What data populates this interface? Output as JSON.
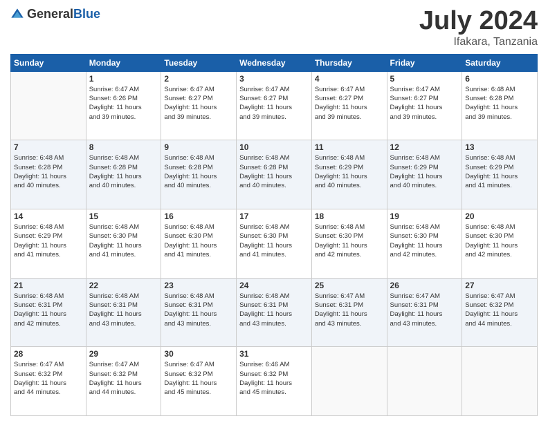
{
  "header": {
    "logo_general": "General",
    "logo_blue": "Blue",
    "month_title": "July 2024",
    "location": "Ifakara, Tanzania"
  },
  "days_of_week": [
    "Sunday",
    "Monday",
    "Tuesday",
    "Wednesday",
    "Thursday",
    "Friday",
    "Saturday"
  ],
  "weeks": [
    [
      {
        "day": "",
        "sunrise": "",
        "sunset": "",
        "daylight": "",
        "empty": true
      },
      {
        "day": "1",
        "sunrise": "Sunrise: 6:47 AM",
        "sunset": "Sunset: 6:26 PM",
        "daylight": "Daylight: 11 hours",
        "minutes": "and 39 minutes."
      },
      {
        "day": "2",
        "sunrise": "Sunrise: 6:47 AM",
        "sunset": "Sunset: 6:27 PM",
        "daylight": "Daylight: 11 hours",
        "minutes": "and 39 minutes."
      },
      {
        "day": "3",
        "sunrise": "Sunrise: 6:47 AM",
        "sunset": "Sunset: 6:27 PM",
        "daylight": "Daylight: 11 hours",
        "minutes": "and 39 minutes."
      },
      {
        "day": "4",
        "sunrise": "Sunrise: 6:47 AM",
        "sunset": "Sunset: 6:27 PM",
        "daylight": "Daylight: 11 hours",
        "minutes": "and 39 minutes."
      },
      {
        "day": "5",
        "sunrise": "Sunrise: 6:47 AM",
        "sunset": "Sunset: 6:27 PM",
        "daylight": "Daylight: 11 hours",
        "minutes": "and 39 minutes."
      },
      {
        "day": "6",
        "sunrise": "Sunrise: 6:48 AM",
        "sunset": "Sunset: 6:28 PM",
        "daylight": "Daylight: 11 hours",
        "minutes": "and 39 minutes."
      }
    ],
    [
      {
        "day": "7",
        "sunrise": "Sunrise: 6:48 AM",
        "sunset": "Sunset: 6:28 PM",
        "daylight": "Daylight: 11 hours",
        "minutes": "and 40 minutes."
      },
      {
        "day": "8",
        "sunrise": "Sunrise: 6:48 AM",
        "sunset": "Sunset: 6:28 PM",
        "daylight": "Daylight: 11 hours",
        "minutes": "and 40 minutes."
      },
      {
        "day": "9",
        "sunrise": "Sunrise: 6:48 AM",
        "sunset": "Sunset: 6:28 PM",
        "daylight": "Daylight: 11 hours",
        "minutes": "and 40 minutes."
      },
      {
        "day": "10",
        "sunrise": "Sunrise: 6:48 AM",
        "sunset": "Sunset: 6:28 PM",
        "daylight": "Daylight: 11 hours",
        "minutes": "and 40 minutes."
      },
      {
        "day": "11",
        "sunrise": "Sunrise: 6:48 AM",
        "sunset": "Sunset: 6:29 PM",
        "daylight": "Daylight: 11 hours",
        "minutes": "and 40 minutes."
      },
      {
        "day": "12",
        "sunrise": "Sunrise: 6:48 AM",
        "sunset": "Sunset: 6:29 PM",
        "daylight": "Daylight: 11 hours",
        "minutes": "and 40 minutes."
      },
      {
        "day": "13",
        "sunrise": "Sunrise: 6:48 AM",
        "sunset": "Sunset: 6:29 PM",
        "daylight": "Daylight: 11 hours",
        "minutes": "and 41 minutes."
      }
    ],
    [
      {
        "day": "14",
        "sunrise": "Sunrise: 6:48 AM",
        "sunset": "Sunset: 6:29 PM",
        "daylight": "Daylight: 11 hours",
        "minutes": "and 41 minutes."
      },
      {
        "day": "15",
        "sunrise": "Sunrise: 6:48 AM",
        "sunset": "Sunset: 6:30 PM",
        "daylight": "Daylight: 11 hours",
        "minutes": "and 41 minutes."
      },
      {
        "day": "16",
        "sunrise": "Sunrise: 6:48 AM",
        "sunset": "Sunset: 6:30 PM",
        "daylight": "Daylight: 11 hours",
        "minutes": "and 41 minutes."
      },
      {
        "day": "17",
        "sunrise": "Sunrise: 6:48 AM",
        "sunset": "Sunset: 6:30 PM",
        "daylight": "Daylight: 11 hours",
        "minutes": "and 41 minutes."
      },
      {
        "day": "18",
        "sunrise": "Sunrise: 6:48 AM",
        "sunset": "Sunset: 6:30 PM",
        "daylight": "Daylight: 11 hours",
        "minutes": "and 42 minutes."
      },
      {
        "day": "19",
        "sunrise": "Sunrise: 6:48 AM",
        "sunset": "Sunset: 6:30 PM",
        "daylight": "Daylight: 11 hours",
        "minutes": "and 42 minutes."
      },
      {
        "day": "20",
        "sunrise": "Sunrise: 6:48 AM",
        "sunset": "Sunset: 6:30 PM",
        "daylight": "Daylight: 11 hours",
        "minutes": "and 42 minutes."
      }
    ],
    [
      {
        "day": "21",
        "sunrise": "Sunrise: 6:48 AM",
        "sunset": "Sunset: 6:31 PM",
        "daylight": "Daylight: 11 hours",
        "minutes": "and 42 minutes."
      },
      {
        "day": "22",
        "sunrise": "Sunrise: 6:48 AM",
        "sunset": "Sunset: 6:31 PM",
        "daylight": "Daylight: 11 hours",
        "minutes": "and 43 minutes."
      },
      {
        "day": "23",
        "sunrise": "Sunrise: 6:48 AM",
        "sunset": "Sunset: 6:31 PM",
        "daylight": "Daylight: 11 hours",
        "minutes": "and 43 minutes."
      },
      {
        "day": "24",
        "sunrise": "Sunrise: 6:48 AM",
        "sunset": "Sunset: 6:31 PM",
        "daylight": "Daylight: 11 hours",
        "minutes": "and 43 minutes."
      },
      {
        "day": "25",
        "sunrise": "Sunrise: 6:47 AM",
        "sunset": "Sunset: 6:31 PM",
        "daylight": "Daylight: 11 hours",
        "minutes": "and 43 minutes."
      },
      {
        "day": "26",
        "sunrise": "Sunrise: 6:47 AM",
        "sunset": "Sunset: 6:31 PM",
        "daylight": "Daylight: 11 hours",
        "minutes": "and 43 minutes."
      },
      {
        "day": "27",
        "sunrise": "Sunrise: 6:47 AM",
        "sunset": "Sunset: 6:32 PM",
        "daylight": "Daylight: 11 hours",
        "minutes": "and 44 minutes."
      }
    ],
    [
      {
        "day": "28",
        "sunrise": "Sunrise: 6:47 AM",
        "sunset": "Sunset: 6:32 PM",
        "daylight": "Daylight: 11 hours",
        "minutes": "and 44 minutes."
      },
      {
        "day": "29",
        "sunrise": "Sunrise: 6:47 AM",
        "sunset": "Sunset: 6:32 PM",
        "daylight": "Daylight: 11 hours",
        "minutes": "and 44 minutes."
      },
      {
        "day": "30",
        "sunrise": "Sunrise: 6:47 AM",
        "sunset": "Sunset: 6:32 PM",
        "daylight": "Daylight: 11 hours",
        "minutes": "and 45 minutes."
      },
      {
        "day": "31",
        "sunrise": "Sunrise: 6:46 AM",
        "sunset": "Sunset: 6:32 PM",
        "daylight": "Daylight: 11 hours",
        "minutes": "and 45 minutes."
      },
      {
        "day": "",
        "empty": true
      },
      {
        "day": "",
        "empty": true
      },
      {
        "day": "",
        "empty": true
      }
    ]
  ]
}
